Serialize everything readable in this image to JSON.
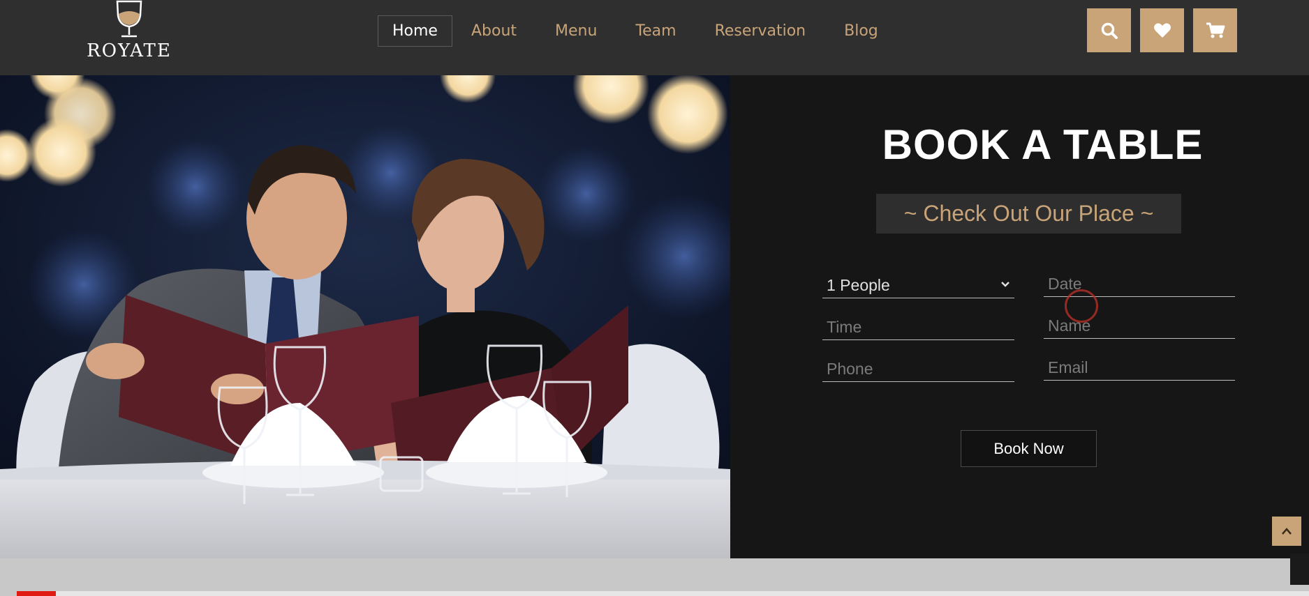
{
  "brand": {
    "name": "ROYATE"
  },
  "nav": {
    "items": [
      {
        "label": "Home",
        "active": true
      },
      {
        "label": "About"
      },
      {
        "label": "Menu"
      },
      {
        "label": "Team"
      },
      {
        "label": "Reservation"
      },
      {
        "label": "Blog"
      }
    ],
    "icons": [
      "search-icon",
      "heart-icon",
      "cart-icon"
    ]
  },
  "booking": {
    "title": "BOOK A TABLE",
    "subtitle": "~ Check Out Our Place ~",
    "people": {
      "value": "1 People"
    },
    "date": {
      "placeholder": "Date"
    },
    "time": {
      "placeholder": "Time"
    },
    "name": {
      "placeholder": "Name"
    },
    "phone": {
      "placeholder": "Phone"
    },
    "email": {
      "placeholder": "Email"
    },
    "button_label": "Book Now"
  },
  "video_progress": {
    "fraction": 0.03
  },
  "colors": {
    "accent": "#c9a478",
    "navbar_bg": "#2f2f2f",
    "panel_bg": "#161616",
    "progress_red": "#e01b14"
  }
}
